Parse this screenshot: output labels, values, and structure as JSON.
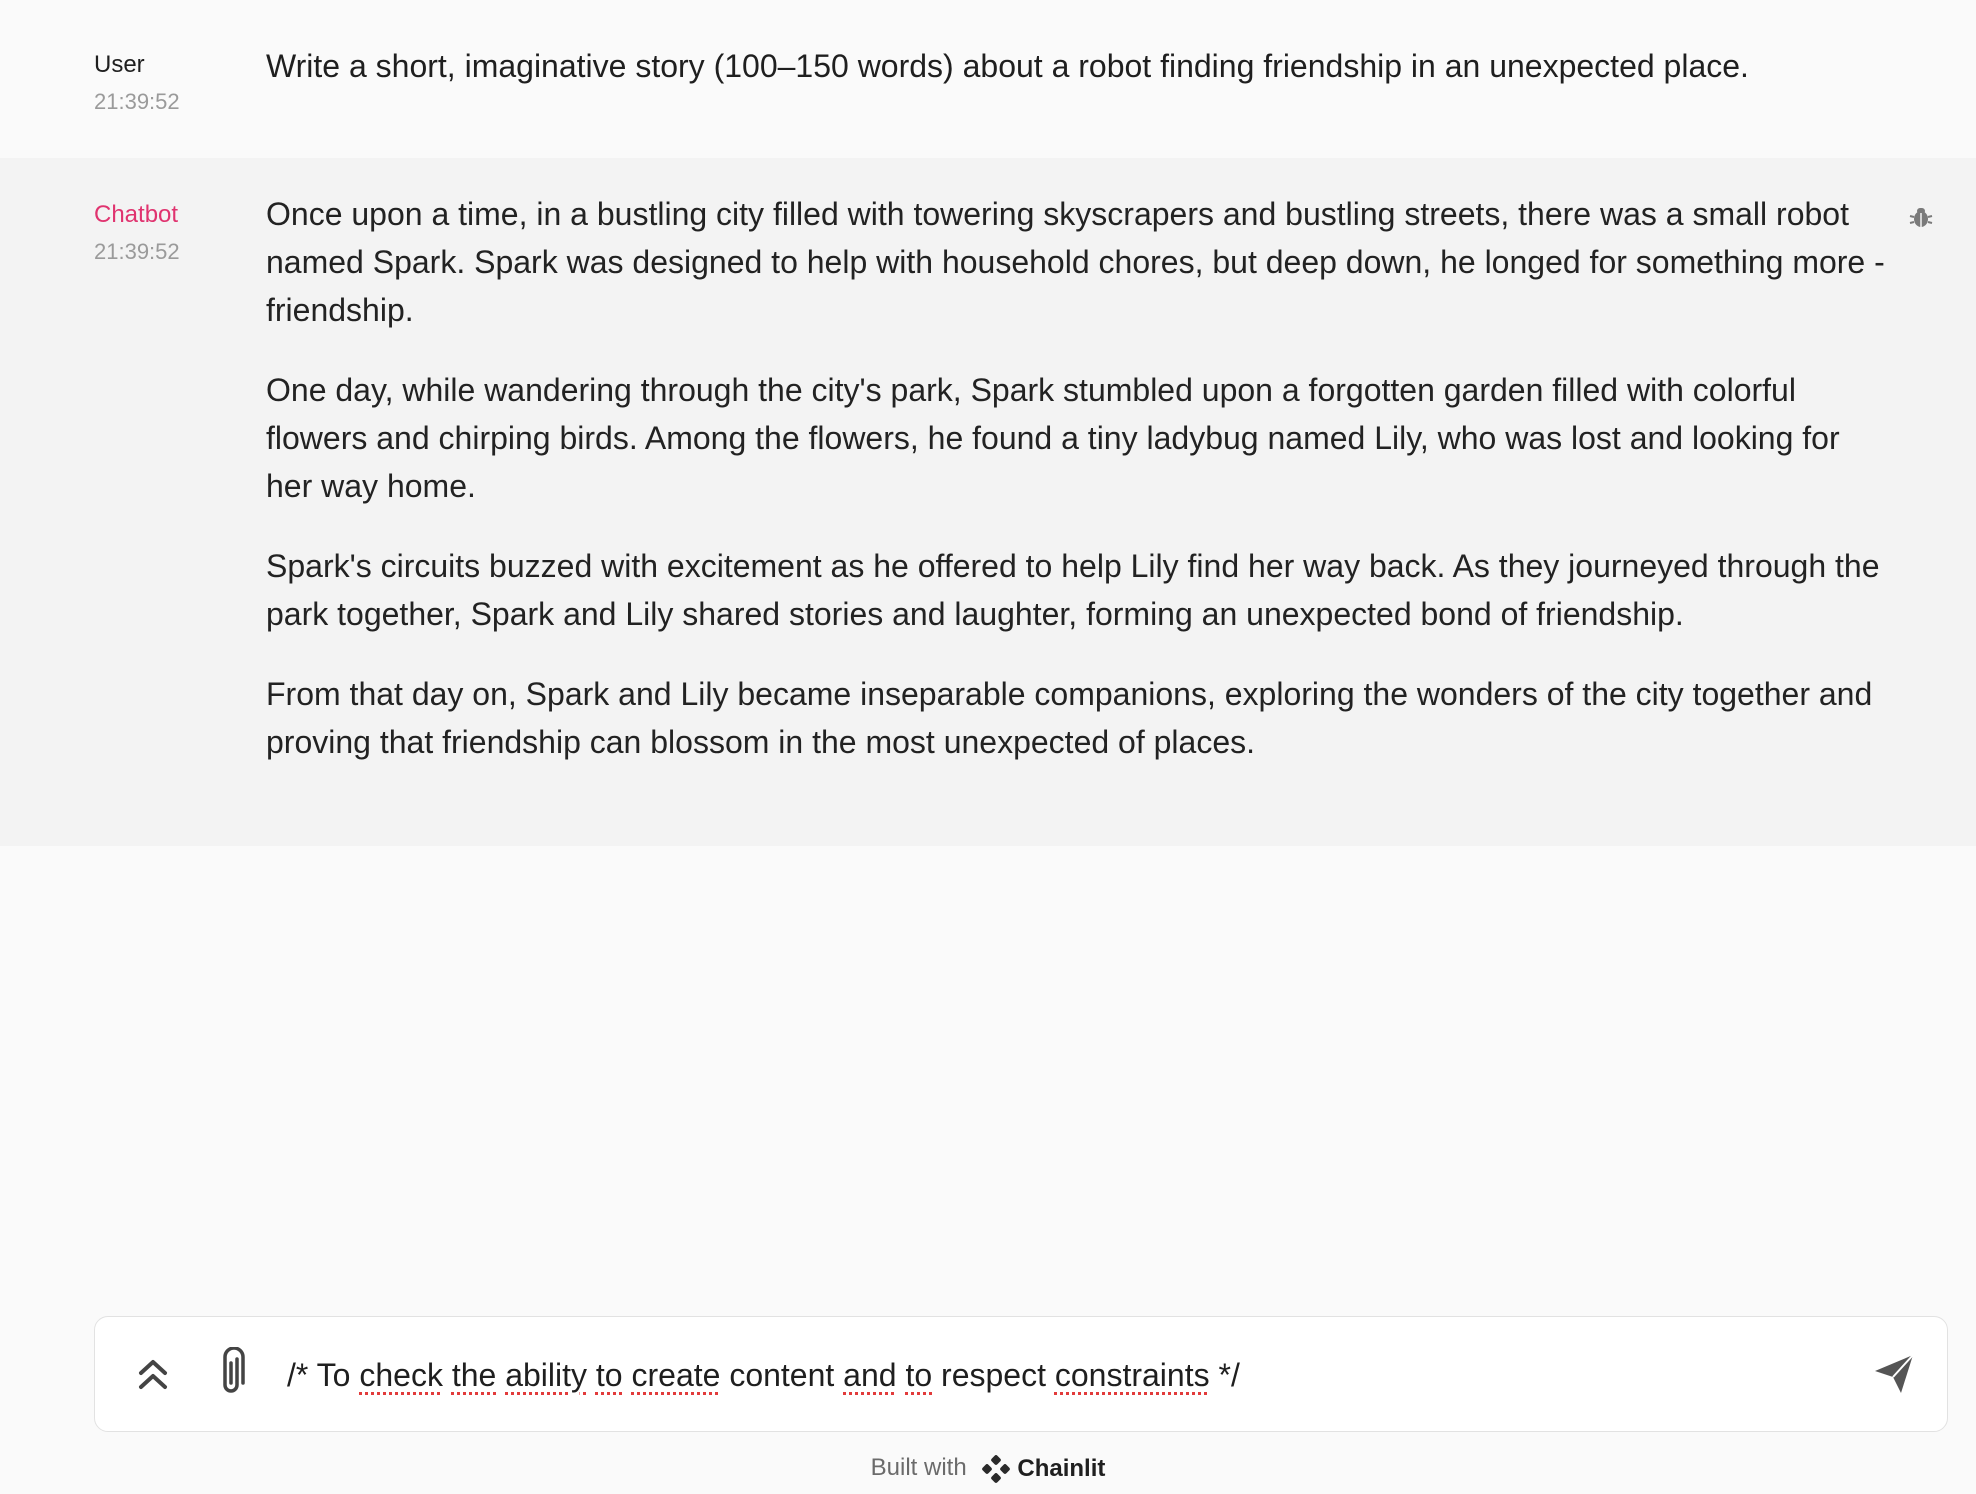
{
  "messages": {
    "user": {
      "author": "User",
      "time": "21:39:52",
      "text": "Write a short, imaginative story (100–150 words) about a robot finding friendship in an unexpected place."
    },
    "bot": {
      "author": "Chatbot",
      "time": "21:39:52",
      "paragraphs": [
        "Once upon a time, in a bustling city filled with towering skyscrapers and bustling streets, there was a small robot named Spark. Spark was designed to help with household chores, but deep down, he longed for something more - friendship.",
        "One day, while wandering through the city's park, Spark stumbled upon a forgotten garden filled with colorful flowers and chirping birds. Among the flowers, he found a tiny ladybug named Lily, who was lost and looking for her way home.",
        "Spark's circuits buzzed with excitement as he offered to help Lily find her way back. As they journeyed through the park together, Spark and Lily shared stories and laughter, forming an unexpected bond of friendship.",
        "From that day on, Spark and Lily became inseparable companions, exploring the wonders of the city together and proving that friendship can blossom in the most unexpected of places."
      ],
      "icon": "bug-icon"
    }
  },
  "composer": {
    "value_parts": [
      "/* To ",
      "check",
      " ",
      "the",
      " ",
      "ability",
      " ",
      "to",
      " ",
      "create",
      " content ",
      "and",
      " ",
      "to",
      " respect ",
      "constraints",
      "  */"
    ],
    "icons": {
      "expand": "chevrons-up-icon",
      "attach": "paperclip-icon",
      "send": "send-icon"
    }
  },
  "footer": {
    "built_with": "Built with",
    "brand": "Chainlit"
  },
  "colors": {
    "background": "#fafafa",
    "bot_background": "#f3f3f3",
    "bot_author": "#e0336f",
    "muted": "#9a9a9a",
    "spell_underline": "#e23b3b"
  }
}
